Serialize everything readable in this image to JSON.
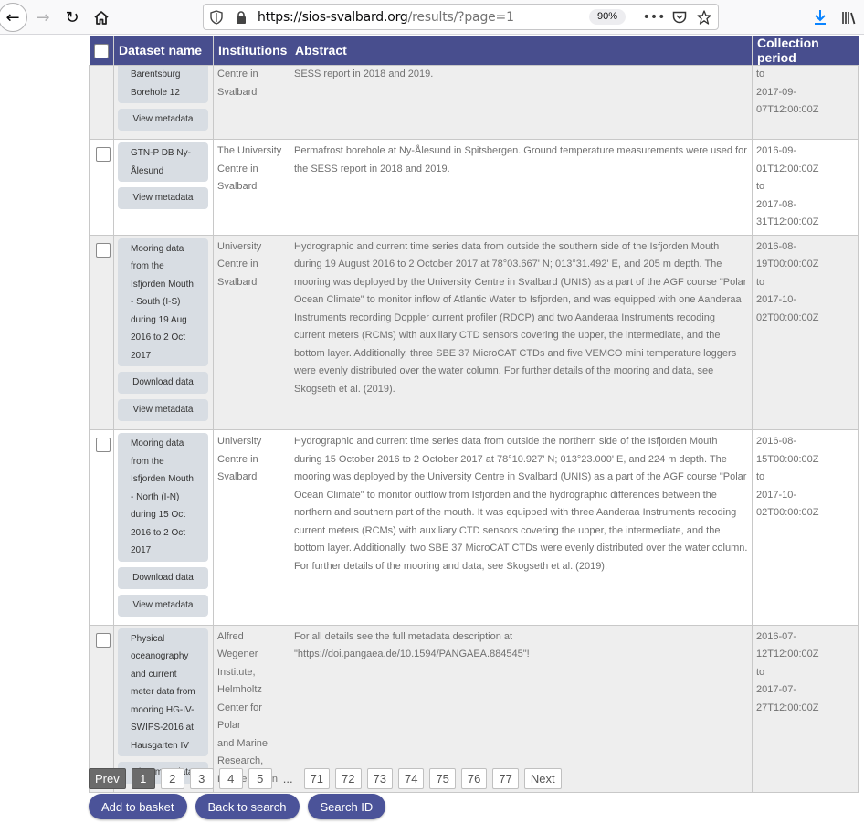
{
  "browser": {
    "url_main": "https://sios-svalbard.org",
    "url_rest": "/results/?page=1",
    "zoom": "90%",
    "more_icon": "•••"
  },
  "table": {
    "headers": [
      "Dataset name",
      "Institutions",
      "Abstract",
      "Collection period"
    ],
    "rows": [
      {
        "name_lines": [
          "Barentsburg",
          "Borehole 12"
        ],
        "institution_lines": [
          "Centre in",
          "Svalbard"
        ],
        "abstract": "SESS report in 2018 and 2019.",
        "period_lines": [
          "to",
          "2017-09-07T12:00:00Z"
        ],
        "buttons": [
          "View metadata"
        ],
        "has_checkbox": false
      },
      {
        "name_lines": [
          "GTN-P DB Ny-",
          "Ålesund"
        ],
        "institution_lines": [
          "The University",
          "Centre in",
          "Svalbard"
        ],
        "abstract": "Permafrost borehole at Ny-Ålesund in Spitsbergen. Ground temperature measurements were used for the SESS report in 2018 and 2019.",
        "period_lines": [
          "2016-09-01T12:00:00Z",
          "to",
          "2017-08-31T12:00:00Z"
        ],
        "buttons": [
          "View metadata"
        ],
        "has_checkbox": true
      },
      {
        "name_lines": [
          "Mooring data",
          "from the",
          "Isfjorden Mouth",
          "- South (I-S)",
          "during 19 Aug",
          "2016 to 2 Oct",
          "2017"
        ],
        "institution_lines": [
          "University",
          "Centre in",
          "Svalbard"
        ],
        "abstract": "Hydrographic and current time series data from outside the southern side of the Isfjorden Mouth during 19 August 2016 to 2 October 2017 at 78°03.667' N; 013°31.492' E, and 205 m depth. The mooring was deployed by the University Centre in Svalbard (UNIS) as a part of the AGF course \"Polar Ocean Climate\" to monitor inflow of Atlantic Water to Isfjorden, and was equipped with one Aanderaa Instruments recording Doppler current profiler (RDCP) and two Aanderaa Instruments recoding current meters (RCMs) with auxiliary CTD sensors covering the upper, the intermediate, and the bottom layer. Additionally, three SBE 37 MicroCAT CTDs and five VEMCO mini temperature loggers were evenly distributed over the water column. For further details of the mooring and data, see Skogseth et al. (2019).",
        "period_lines": [
          "2016-08-19T00:00:00Z",
          "to",
          "2017-10-02T00:00:00Z"
        ],
        "buttons": [
          "Download data",
          "View metadata"
        ],
        "has_checkbox": true
      },
      {
        "name_lines": [
          "Mooring data",
          "from the",
          "Isfjorden Mouth",
          "- North (I-N)",
          "during 15 Oct",
          "2016 to 2 Oct",
          "2017"
        ],
        "institution_lines": [
          "University",
          "Centre in",
          "Svalbard"
        ],
        "abstract": "Hydrographic and current time series data from outside the northern side of the Isfjorden Mouth during 15 October 2016 to 2 October 2017 at 78°10.927' N; 013°23.000' E, and 224 m depth. The mooring was deployed by the University Centre in Svalbard (UNIS) as a part of the AGF course \"Polar Ocean Climate\" to monitor outflow from Isfjorden and the hydrographic differences between the northern and southern part of the mouth. It was equipped with three Aanderaa Instruments recoding current meters (RCMs) with auxiliary CTD sensors covering the upper, the intermediate, and the bottom layer. Additionally, two SBE 37 MicroCAT CTDs were evenly distributed over the water column. For further details of the mooring and data, see Skogseth et al. (2019).",
        "period_lines": [
          "2016-08-15T00:00:00Z",
          "to",
          "2017-10-02T00:00:00Z"
        ],
        "buttons": [
          "Download data",
          "View metadata"
        ],
        "has_checkbox": true
      },
      {
        "name_lines": [
          "Physical",
          "oceanography",
          "and current",
          "meter data from",
          "mooring HG-IV-",
          "SWIPS-2016 at",
          "Hausgarten IV"
        ],
        "institution_lines": [
          "Alfred Wegener",
          "Institute,",
          "Helmholtz",
          "Center for Polar",
          "and Marine",
          "Research,",
          "Bremerhaven"
        ],
        "abstract": "For all details see the full metadata description at \"https://doi.pangaea.de/10.1594/PANGAEA.884545\"!",
        "period_lines": [
          "2016-07-12T12:00:00Z",
          "to",
          "2017-07-27T12:00:00Z"
        ],
        "buttons": [
          "View metadata"
        ],
        "has_checkbox": true
      }
    ]
  },
  "pager": {
    "prev": "Prev",
    "pages": [
      "1",
      "2",
      "3",
      "4",
      "5",
      "...",
      "71",
      "72",
      "73",
      "74",
      "75",
      "76",
      "77"
    ],
    "next": "Next",
    "current": "1"
  },
  "actions": {
    "basket": "Add to basket",
    "back": "Back to search",
    "search_id": "Search ID"
  }
}
